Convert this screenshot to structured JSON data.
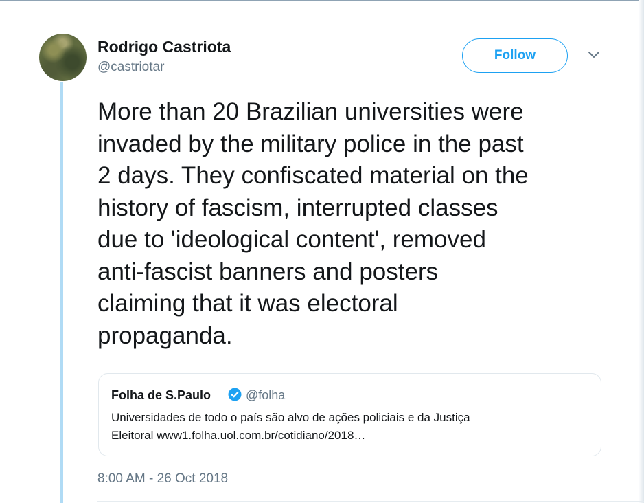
{
  "author": {
    "name": "Rodrigo Castriota",
    "handle": "@castriotar"
  },
  "follow_button": {
    "label": "Follow"
  },
  "tweet": {
    "text_lines": [
      "More than 20 Brazilian universities were",
      "invaded by the military police in the past",
      "2 days. They confiscated material on the",
      "history of fascism, interrupted classes",
      "due to 'ideological content', removed",
      "anti-fascist banners and posters",
      "claiming that it was electoral",
      "propaganda."
    ],
    "timestamp": "8:00 AM - 26 Oct 2018"
  },
  "quoted_tweet": {
    "name": "Folha de S.Paulo",
    "handle": "@folha",
    "verified": true,
    "text_line_1": "Universidades de todo o país são alvo de ações policiais e da Justiça",
    "text_line_2": "Eleitoral www1.folha.uol.com.br/cotidiano/2018…"
  },
  "icons": {
    "caret": "chevron-down-icon",
    "verified": "verified-badge-icon"
  },
  "colors": {
    "accent": "#1da1f2",
    "text": "#14171a",
    "secondary_text": "#657786",
    "thread_line": "#b0dbf5",
    "border": "#e1e8ed"
  }
}
